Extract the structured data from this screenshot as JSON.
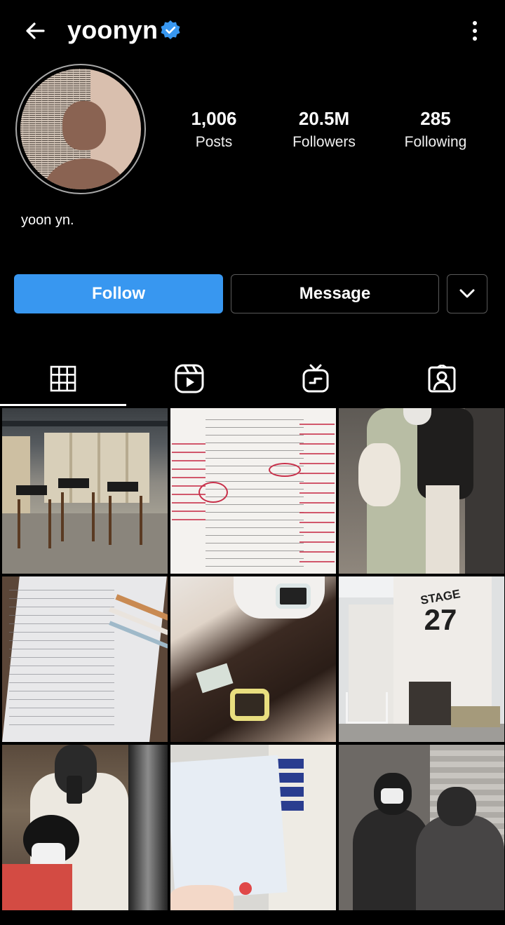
{
  "header": {
    "username": "yoonyn",
    "verified": true
  },
  "profile": {
    "display_name": "yoon yn.",
    "stats": [
      {
        "value": "1,006",
        "label": "Posts"
      },
      {
        "value": "20.5M",
        "label": "Followers"
      },
      {
        "value": "285",
        "label": "Following"
      }
    ]
  },
  "actions": {
    "follow_label": "Follow",
    "message_label": "Message"
  },
  "tabs": [
    {
      "icon": "grid-icon",
      "active": true
    },
    {
      "icon": "reels-icon",
      "active": false
    },
    {
      "icon": "igtv-icon",
      "active": false
    },
    {
      "icon": "tagged-icon",
      "active": false
    }
  ],
  "posts": {
    "p5_text": "STAGE",
    "p5_number": "27"
  },
  "colors": {
    "accent": "#3897f0",
    "verified": "#3897f0",
    "background": "#000000"
  }
}
